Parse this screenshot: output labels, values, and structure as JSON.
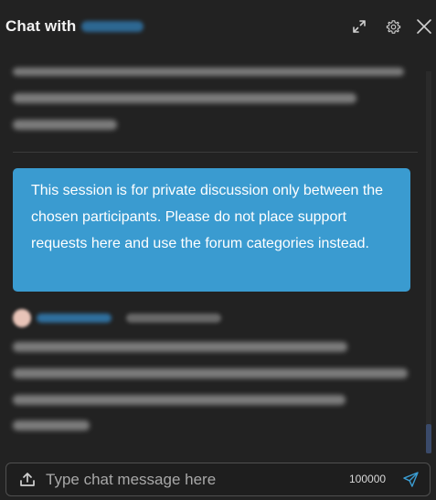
{
  "header": {
    "title": "Chat with",
    "icons": [
      "expand-icon",
      "gear-icon",
      "close-icon"
    ]
  },
  "notice": {
    "text": "This session is for private discussion only between the chosen participants. Please do not place support requests here and use the forum categories instead."
  },
  "composer": {
    "placeholder": "Type chat message here",
    "char_limit": "100000",
    "icons": [
      "upload-icon",
      "send-icon"
    ]
  },
  "colors": {
    "background": "#222222",
    "notice_bg": "#3a9bd0",
    "send_icon": "#3a9bd0",
    "username": "#2f6f9e"
  }
}
